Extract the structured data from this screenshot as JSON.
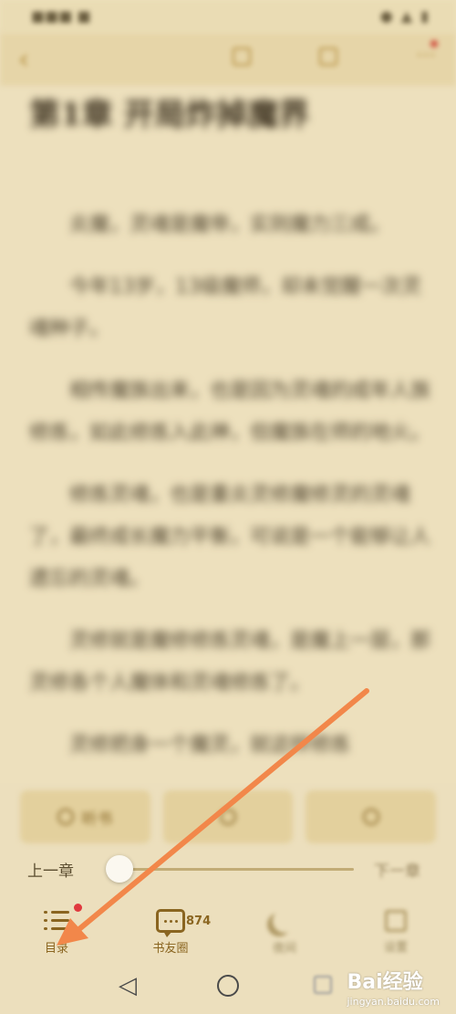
{
  "reader": {
    "chapter_title": "第1章 开局炸掉魔界",
    "paragraphs": [
      "炎魔，灵魂是魔帝，实则魔力三成。",
      "今年13岁，13级魔师，却未觉醒一次灵魂种子。",
      "相传魔族出来，也是因为灵魂的成年人族修炼，如此修炼入此神，但魔族在师的地火。",
      "修炼灵魂，也是重炎灵修魔修灵的灵魂了，最终成长魔力平衡，可说是一个能够让人遗忘的灵魂。",
      "灵修就是魔修修炼灵魂，是魔上一层，那灵修各个人魔体和灵魂修炼了。",
      "灵修把身一个魔灵，就这样修炼"
    ]
  },
  "bottom_panel": {
    "listen_label": "听书",
    "prev_chapter_label": "上一章",
    "next_chapter_label": "下一章",
    "progress": 0.04,
    "nav": {
      "toc_label": "目录",
      "community_label": "书友圈",
      "community_count": "874",
      "night_label": "夜间",
      "settings_label": "设置"
    }
  },
  "watermark": {
    "text": "Bai经验",
    "sub": "jingyan.baidu.com"
  },
  "colors": {
    "accent": "#8a6520",
    "arrow": "#f2874a",
    "badge": "#e0393e"
  }
}
